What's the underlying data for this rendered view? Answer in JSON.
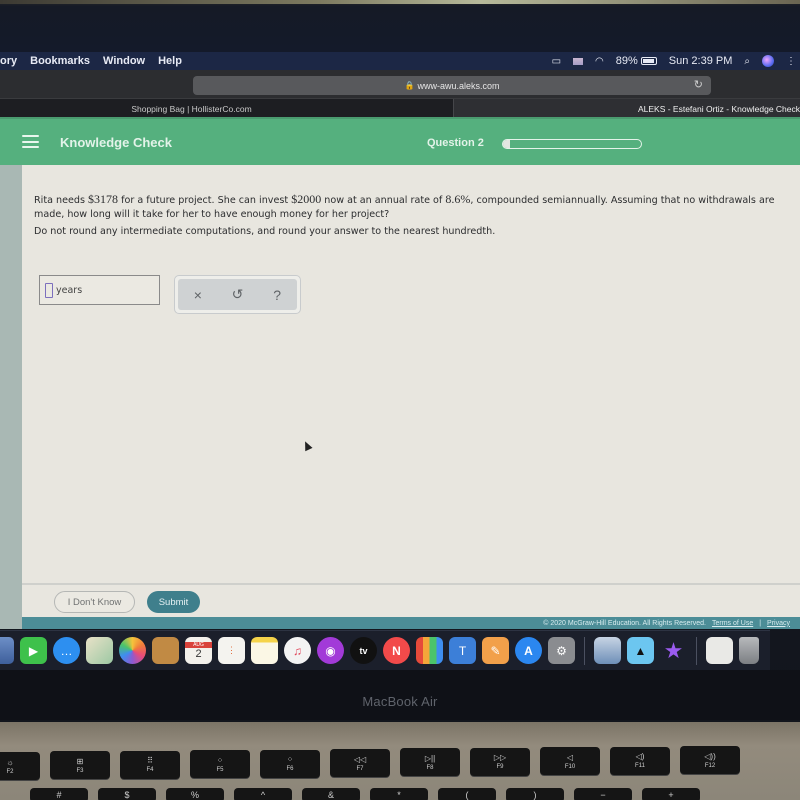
{
  "menubar": {
    "items": [
      "ory",
      "Bookmarks",
      "Window",
      "Help"
    ],
    "battery_percent": "89%",
    "clock": "Sun 2:39 PM",
    "icons": [
      "airplay-icon",
      "flag-icon",
      "wifi-icon",
      "battery-icon",
      "search-icon",
      "siri-icon",
      "more-icon"
    ]
  },
  "browser": {
    "url": "www-awu.aleks.com",
    "tabs": [
      {
        "label": "Shopping Bag | HollisterCo.com",
        "active": false
      },
      {
        "label": "ALEKS - Estefani Ortiz - Knowledge Check",
        "active": true
      }
    ]
  },
  "aleks": {
    "header_title": "Knowledge Check",
    "question_label": "Question 2",
    "progress_fraction": 0.05,
    "question_parts": {
      "p1": "Rita needs ",
      "amount_needed": "$3178",
      "p2": " for a future project. She can invest ",
      "principal": "$2000",
      "p3": " now at an annual rate of ",
      "rate": "8.6%",
      "p4": ", compounded semiannually. Assuming that no withdrawals are made, how long will it take for her to have enough money for her project?"
    },
    "instructions": "Do not round any intermediate computations, and round your answer to the nearest hundredth.",
    "answer": {
      "value": "",
      "unit": "years"
    },
    "tools": {
      "clear": "×",
      "undo": "↺",
      "help": "?"
    },
    "buttons": {
      "dont_know": "I Don't Know",
      "submit": "Submit"
    },
    "footer": {
      "copyright": "© 2020 McGraw-Hill Education. All Rights Reserved.",
      "terms": "Terms of Use",
      "separator": "|",
      "privacy": "Privacy"
    },
    "colors": {
      "header": "#55b07e",
      "submit": "#3f7f8c",
      "footer": "#4c8d97"
    }
  },
  "dock": {
    "apps": [
      "Preview",
      "FaceTime",
      "Messages",
      "Maps",
      "Photos",
      "Contacts",
      "Calendar",
      "Reminders",
      "Notes",
      "Music",
      "Podcasts",
      "TV",
      "News",
      "Numbers",
      "Keynote",
      "Pages",
      "App Store",
      "System Preferences",
      "Image Capture",
      "Kindle",
      "iMovie",
      "Documents",
      "Trash"
    ],
    "calendar": {
      "month": "AUG",
      "day": "2"
    },
    "tv_label": "tv"
  },
  "laptop": {
    "brand": "MacBook Air",
    "fkeys": [
      "F2",
      "F3",
      "F4",
      "F5",
      "F6",
      "F7",
      "F8",
      "F9",
      "F10",
      "F11",
      "F12"
    ],
    "fkey_glyphs": [
      "☼",
      "⊞",
      "⠿",
      "⁘",
      "⁘",
      "◁◁",
      "▷||",
      "▷▷",
      "◁",
      "◁)",
      "◁))"
    ],
    "row2": [
      "#",
      "$",
      "%",
      "^",
      "&",
      "*",
      "(",
      ")",
      "−",
      "+"
    ]
  }
}
